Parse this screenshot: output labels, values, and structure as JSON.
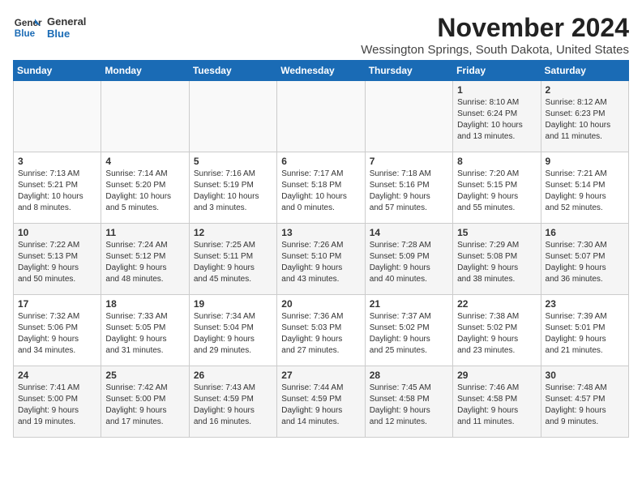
{
  "logo": {
    "line1": "General",
    "line2": "Blue"
  },
  "title": "November 2024",
  "location": "Wessington Springs, South Dakota, United States",
  "weekdays": [
    "Sunday",
    "Monday",
    "Tuesday",
    "Wednesday",
    "Thursday",
    "Friday",
    "Saturday"
  ],
  "weeks": [
    [
      {
        "day": "",
        "info": ""
      },
      {
        "day": "",
        "info": ""
      },
      {
        "day": "",
        "info": ""
      },
      {
        "day": "",
        "info": ""
      },
      {
        "day": "",
        "info": ""
      },
      {
        "day": "1",
        "info": "Sunrise: 8:10 AM\nSunset: 6:24 PM\nDaylight: 10 hours\nand 13 minutes."
      },
      {
        "day": "2",
        "info": "Sunrise: 8:12 AM\nSunset: 6:23 PM\nDaylight: 10 hours\nand 11 minutes."
      }
    ],
    [
      {
        "day": "3",
        "info": "Sunrise: 7:13 AM\nSunset: 5:21 PM\nDaylight: 10 hours\nand 8 minutes."
      },
      {
        "day": "4",
        "info": "Sunrise: 7:14 AM\nSunset: 5:20 PM\nDaylight: 10 hours\nand 5 minutes."
      },
      {
        "day": "5",
        "info": "Sunrise: 7:16 AM\nSunset: 5:19 PM\nDaylight: 10 hours\nand 3 minutes."
      },
      {
        "day": "6",
        "info": "Sunrise: 7:17 AM\nSunset: 5:18 PM\nDaylight: 10 hours\nand 0 minutes."
      },
      {
        "day": "7",
        "info": "Sunrise: 7:18 AM\nSunset: 5:16 PM\nDaylight: 9 hours\nand 57 minutes."
      },
      {
        "day": "8",
        "info": "Sunrise: 7:20 AM\nSunset: 5:15 PM\nDaylight: 9 hours\nand 55 minutes."
      },
      {
        "day": "9",
        "info": "Sunrise: 7:21 AM\nSunset: 5:14 PM\nDaylight: 9 hours\nand 52 minutes."
      }
    ],
    [
      {
        "day": "10",
        "info": "Sunrise: 7:22 AM\nSunset: 5:13 PM\nDaylight: 9 hours\nand 50 minutes."
      },
      {
        "day": "11",
        "info": "Sunrise: 7:24 AM\nSunset: 5:12 PM\nDaylight: 9 hours\nand 48 minutes."
      },
      {
        "day": "12",
        "info": "Sunrise: 7:25 AM\nSunset: 5:11 PM\nDaylight: 9 hours\nand 45 minutes."
      },
      {
        "day": "13",
        "info": "Sunrise: 7:26 AM\nSunset: 5:10 PM\nDaylight: 9 hours\nand 43 minutes."
      },
      {
        "day": "14",
        "info": "Sunrise: 7:28 AM\nSunset: 5:09 PM\nDaylight: 9 hours\nand 40 minutes."
      },
      {
        "day": "15",
        "info": "Sunrise: 7:29 AM\nSunset: 5:08 PM\nDaylight: 9 hours\nand 38 minutes."
      },
      {
        "day": "16",
        "info": "Sunrise: 7:30 AM\nSunset: 5:07 PM\nDaylight: 9 hours\nand 36 minutes."
      }
    ],
    [
      {
        "day": "17",
        "info": "Sunrise: 7:32 AM\nSunset: 5:06 PM\nDaylight: 9 hours\nand 34 minutes."
      },
      {
        "day": "18",
        "info": "Sunrise: 7:33 AM\nSunset: 5:05 PM\nDaylight: 9 hours\nand 31 minutes."
      },
      {
        "day": "19",
        "info": "Sunrise: 7:34 AM\nSunset: 5:04 PM\nDaylight: 9 hours\nand 29 minutes."
      },
      {
        "day": "20",
        "info": "Sunrise: 7:36 AM\nSunset: 5:03 PM\nDaylight: 9 hours\nand 27 minutes."
      },
      {
        "day": "21",
        "info": "Sunrise: 7:37 AM\nSunset: 5:02 PM\nDaylight: 9 hours\nand 25 minutes."
      },
      {
        "day": "22",
        "info": "Sunrise: 7:38 AM\nSunset: 5:02 PM\nDaylight: 9 hours\nand 23 minutes."
      },
      {
        "day": "23",
        "info": "Sunrise: 7:39 AM\nSunset: 5:01 PM\nDaylight: 9 hours\nand 21 minutes."
      }
    ],
    [
      {
        "day": "24",
        "info": "Sunrise: 7:41 AM\nSunset: 5:00 PM\nDaylight: 9 hours\nand 19 minutes."
      },
      {
        "day": "25",
        "info": "Sunrise: 7:42 AM\nSunset: 5:00 PM\nDaylight: 9 hours\nand 17 minutes."
      },
      {
        "day": "26",
        "info": "Sunrise: 7:43 AM\nSunset: 4:59 PM\nDaylight: 9 hours\nand 16 minutes."
      },
      {
        "day": "27",
        "info": "Sunrise: 7:44 AM\nSunset: 4:59 PM\nDaylight: 9 hours\nand 14 minutes."
      },
      {
        "day": "28",
        "info": "Sunrise: 7:45 AM\nSunset: 4:58 PM\nDaylight: 9 hours\nand 12 minutes."
      },
      {
        "day": "29",
        "info": "Sunrise: 7:46 AM\nSunset: 4:58 PM\nDaylight: 9 hours\nand 11 minutes."
      },
      {
        "day": "30",
        "info": "Sunrise: 7:48 AM\nSunset: 4:57 PM\nDaylight: 9 hours\nand 9 minutes."
      }
    ]
  ]
}
